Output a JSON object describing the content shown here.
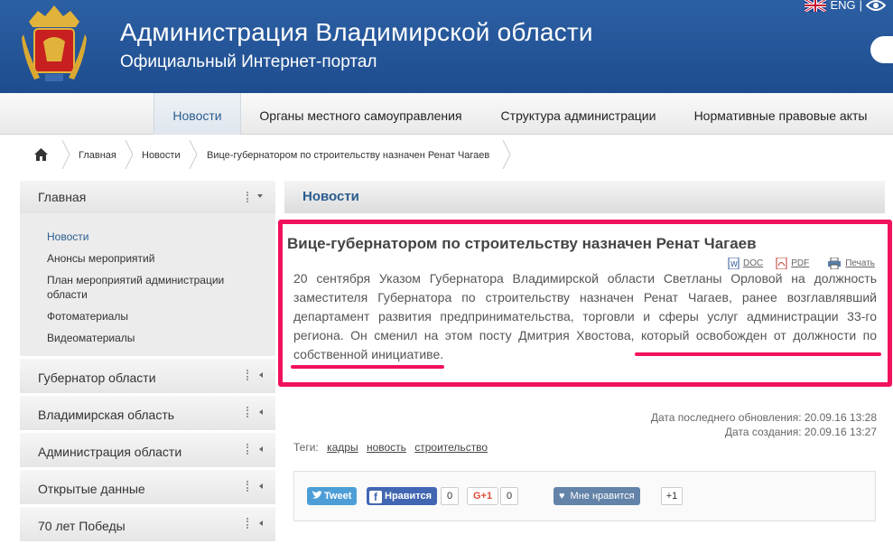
{
  "header": {
    "title": "Администрация Владимирской области",
    "subtitle": "Официальный Интернет-портал",
    "lang_label": "ENG",
    "lang_sep": "|"
  },
  "nav": {
    "items": [
      "Новости",
      "Органы местного самоуправления",
      "Структура администрации",
      "Нормативные правовые акты"
    ]
  },
  "breadcrumb": {
    "items": [
      "Главная",
      "Новости",
      "Вице-губернатором по строительству назначен Ренат Чагаев"
    ]
  },
  "sidebar": {
    "head": "Главная",
    "sub_items": [
      "Новости",
      "Анонсы мероприятий",
      "План мероприятий администрации области",
      "Фотоматериалы",
      "Видеоматериалы"
    ],
    "sections": [
      "Губернатор области",
      "Владимирская область",
      "Администрация области",
      "Открытые данные",
      "70 лет Победы"
    ]
  },
  "main": {
    "section_title": "Новости",
    "news_title": "Вице-губернатором по строительству назначен Ренат Чагаев",
    "doc_label": "DOC",
    "pdf_label": "PDF",
    "print_label": "Печать",
    "body": "20 сентября Указом Губернатора Владимирской области Светланы Орловой на должность заместителя Губернатора по строительству назначен Ренат Чагаев, ранее возглавлявший департамент развития предпринимательства, торговли и сферы услуг администрации 33-го региона. Он сменил на этом посту Дмитрия Хвостова, который освобожден от должности по собственной инициативе.",
    "updated": "Дата последнего обновления: 20.09.16 13:28",
    "created": "Дата создания: 20.09.16 13:27",
    "tags_label": "Теги:",
    "tags": [
      "кадры",
      "новость",
      "строительство"
    ]
  },
  "social": {
    "tweet": "Tweet",
    "fb": "Нравится",
    "fb_count": "0",
    "gplus": "G+1",
    "gplus_count": "0",
    "vk": "Мне нравится",
    "vk_count": "+1"
  },
  "colors": {
    "header_blue": "#2c5fa3",
    "accent_blue": "#2a5d8f",
    "highlight": "#f0115f"
  }
}
